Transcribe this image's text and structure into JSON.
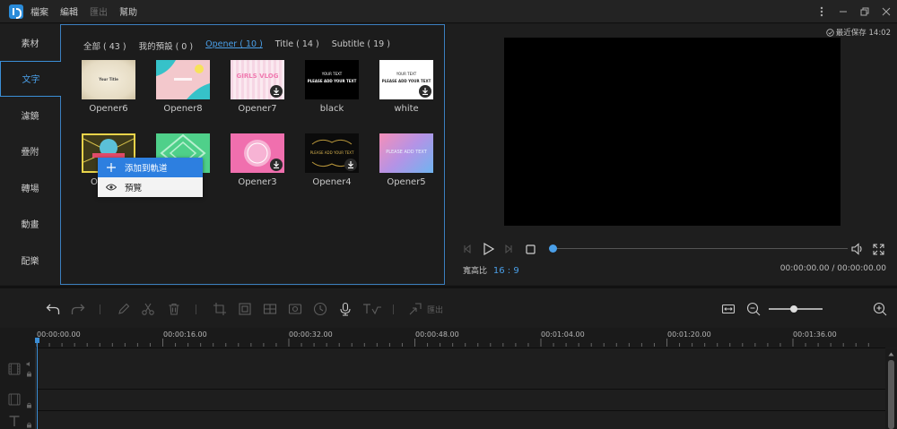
{
  "menu": {
    "items": [
      {
        "label": "檔案",
        "disabled": false
      },
      {
        "label": "編輯",
        "disabled": false
      },
      {
        "label": "匯出",
        "disabled": true
      },
      {
        "label": "幫助",
        "disabled": false
      }
    ]
  },
  "sidebar": {
    "items": [
      {
        "label": "素材"
      },
      {
        "label": "文字",
        "active": true
      },
      {
        "label": "濾鏡"
      },
      {
        "label": "疊附"
      },
      {
        "label": "轉場"
      },
      {
        "label": "動畫"
      },
      {
        "label": "配樂"
      }
    ]
  },
  "library": {
    "tabs": [
      {
        "label": "全部 ( 43 )"
      },
      {
        "label": "我的預設 ( 0 )"
      },
      {
        "label": "Opener ( 10 )",
        "active": true
      },
      {
        "label": "Title ( 14 )"
      },
      {
        "label": "Subtitle ( 19 )"
      }
    ],
    "tiles": [
      {
        "label": "Opener6",
        "thumb_text": "Your Title"
      },
      {
        "label": "Opener8",
        "thumb_text": ""
      },
      {
        "label": "Opener7",
        "thumb_text": "GIRLS VLOG"
      },
      {
        "label": "black",
        "thumb_text_1": "YOUR TEXT",
        "thumb_text_2": "PLEASE ADD YOUR TEXT"
      },
      {
        "label": "white",
        "thumb_text_1": "YOUR TEXT",
        "thumb_text_2": "PLEASE ADD YOUR TEXT"
      },
      {
        "label": "O",
        "thumb_text": ""
      },
      {
        "label": "",
        "thumb_text": ""
      },
      {
        "label": "Opener3",
        "thumb_text": ""
      },
      {
        "label": "Opener4",
        "thumb_text": "PLEASE ADD YOUR TEXT"
      },
      {
        "label": "Opener5",
        "thumb_text": "PLEASE ADD TEXT"
      }
    ]
  },
  "context_menu": {
    "items": [
      {
        "label": "添加到軌道",
        "icon": "plus-icon",
        "highlighted": true
      },
      {
        "label": "預覽",
        "icon": "eye-icon",
        "highlighted": false
      }
    ]
  },
  "preview": {
    "save_status": "最近保存 14:02",
    "aspect_label": "寬高比",
    "aspect_value": "16 : 9",
    "timecode": "00:00:00.00 / 00:00:00.00",
    "progress": 0
  },
  "toolbar": {
    "export_label": "匯出",
    "zoom_level": 0.45
  },
  "timeline": {
    "ticks": [
      "00:00:00.00",
      "00:00:16.00",
      "00:00:32.00",
      "00:00:48.00",
      "00:01:04.00",
      "00:01:20.00",
      "00:01:36.00"
    ]
  },
  "colors": {
    "accent": "#4a9fe8",
    "menu_highlight": "#2d7fe0",
    "panel_border": "#3b7fbf"
  }
}
